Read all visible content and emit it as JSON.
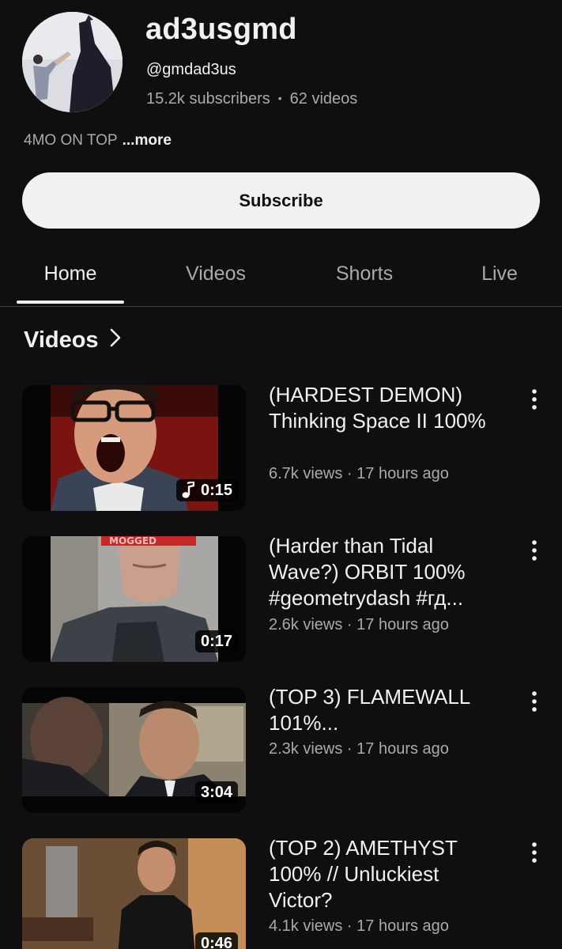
{
  "channel": {
    "name": "ad3usgmd",
    "handle": "@gmdad3us",
    "subscribers": "15.2k subscribers",
    "separator": "•",
    "videos": "62 videos",
    "description": "4MO ON TOP",
    "more_label": "...more",
    "subscribe_label": "Subscribe"
  },
  "tabs": [
    {
      "label": "Home",
      "active": true
    },
    {
      "label": "Videos",
      "active": false
    },
    {
      "label": "Shorts",
      "active": false
    },
    {
      "label": "Live",
      "active": false
    }
  ],
  "section": {
    "title": "Videos",
    "chevron_icon": "chevron-right-icon"
  },
  "videos": [
    {
      "title": "(HARDEST DEMON) Thinking Space II 100%",
      "meta": "6.7k views · 17 hours ago",
      "duration": "0:15",
      "has_music_icon": true
    },
    {
      "title": "(Harder than Tidal Wave?) ORBIT 100% #geometrydash #гд...",
      "meta": "2.6k views · 17 hours ago",
      "duration": "0:17",
      "thumb_caption": "MOGGED",
      "has_music_icon": false
    },
    {
      "title": "(TOP 3) FLAMEWALL 101%...",
      "meta": "2.3k views · 17 hours ago",
      "duration": "3:04",
      "has_music_icon": false
    },
    {
      "title": "(TOP 2) AMETHYST 100% // Unluckiest Victor?",
      "meta": "4.1k views · 17 hours ago",
      "duration": "0:46",
      "has_music_icon": false
    }
  ],
  "colors": {
    "background": "#0f0f0f",
    "text_primary": "#f1f1f1",
    "text_secondary": "#aaaaaa",
    "subscribe_bg": "#f1f1f1"
  }
}
